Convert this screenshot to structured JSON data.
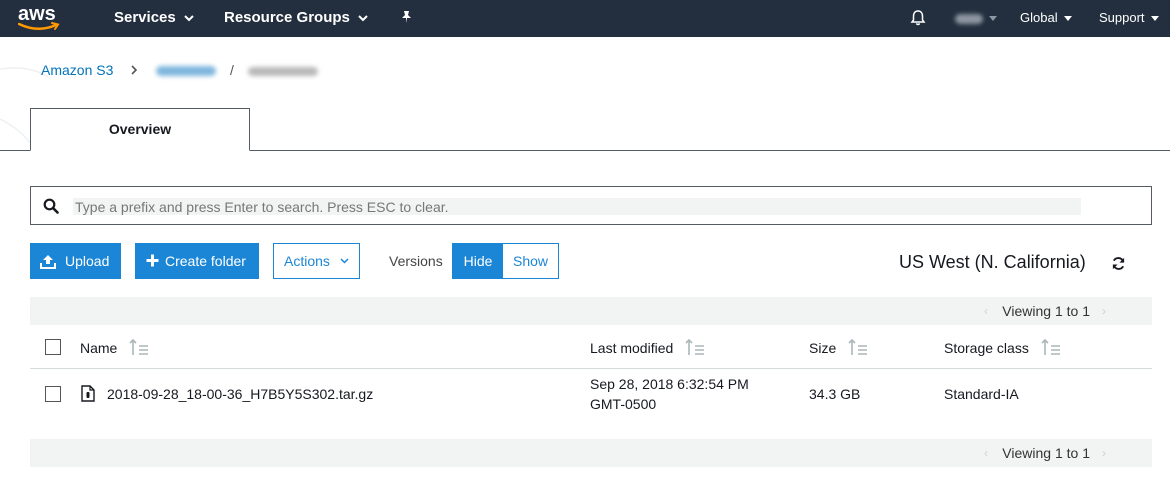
{
  "nav": {
    "logo": "aws",
    "services": "Services",
    "resource_groups": "Resource Groups",
    "region_menu": "Global",
    "support": "Support"
  },
  "breadcrumb": {
    "root": "Amazon S3",
    "separator": "/"
  },
  "tabs": [
    {
      "label": "Overview",
      "active": true
    }
  ],
  "search": {
    "placeholder": "Type a prefix and press Enter to search. Press ESC to clear."
  },
  "toolbar": {
    "upload": "Upload",
    "create_folder": "Create folder",
    "actions": "Actions",
    "versions_label": "Versions",
    "hide": "Hide",
    "show": "Show",
    "region": "US West (N. California)"
  },
  "table": {
    "viewing_top": "Viewing 1 to 1",
    "viewing_bottom": "Viewing 1 to 1",
    "pager_prev": "‹",
    "pager_next": "›",
    "columns": {
      "name": "Name",
      "last_modified": "Last modified",
      "size": "Size",
      "storage_class": "Storage class"
    },
    "rows": [
      {
        "name": "2018-09-28_18-00-36_H7B5Y5S302.tar.gz",
        "last_modified_line1": "Sep 28, 2018 6:32:54 PM",
        "last_modified_line2": "GMT-0500",
        "size": "34.3 GB",
        "storage_class": "Standard-IA"
      }
    ]
  },
  "colors": {
    "nav_bg": "#232f3e",
    "primary": "#1b86d6",
    "link": "#0073bb",
    "aws_orange": "#ff9900"
  }
}
